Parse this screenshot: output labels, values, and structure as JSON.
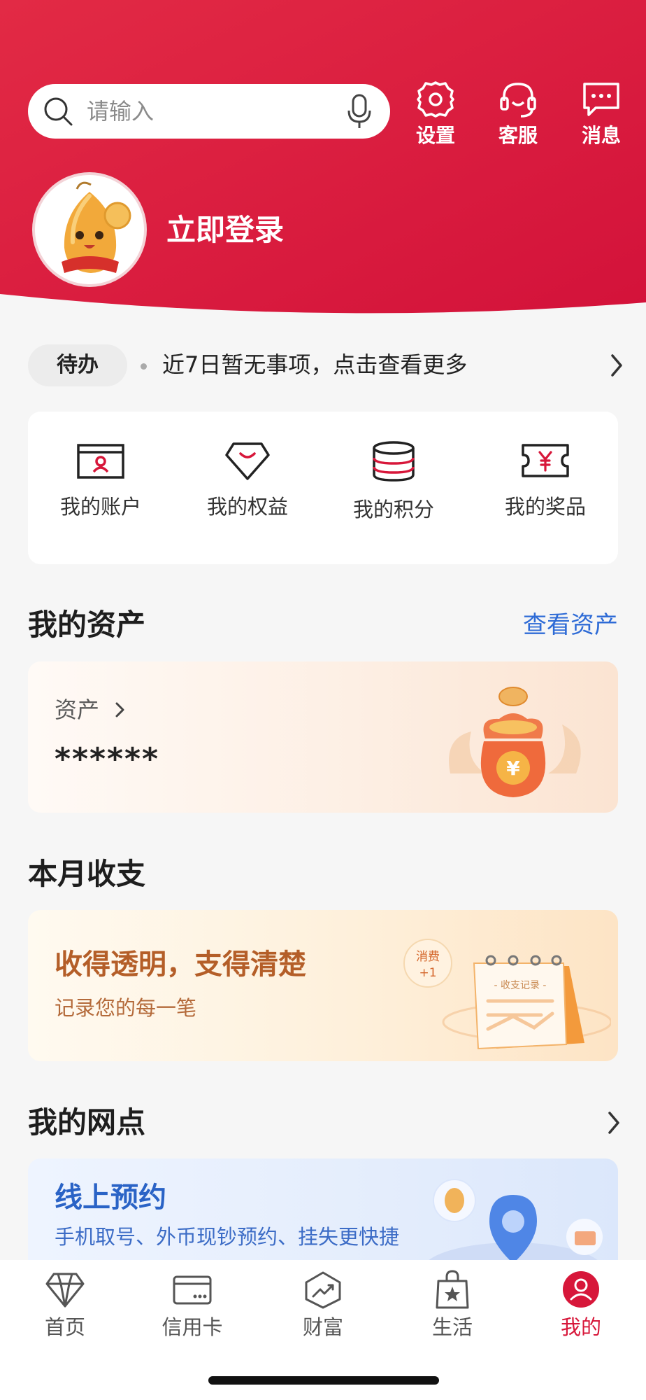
{
  "search": {
    "placeholder": "请输入"
  },
  "header_buttons": [
    {
      "label": "设置",
      "icon": "gear-icon"
    },
    {
      "label": "客服",
      "icon": "headset-icon"
    },
    {
      "label": "消息",
      "icon": "message-icon"
    }
  ],
  "profile": {
    "login_label": "立即登录"
  },
  "todo": {
    "badge": "待办",
    "text": "近7日暂无事项，点击查看更多"
  },
  "quick_grid": [
    {
      "label": "我的账户",
      "icon": "account-card-icon"
    },
    {
      "label": "我的权益",
      "icon": "diamond-benefit-icon"
    },
    {
      "label": "我的积分",
      "icon": "points-coins-icon"
    },
    {
      "label": "我的奖品",
      "icon": "prize-ticket-icon"
    }
  ],
  "assets": {
    "title": "我的资产",
    "link": "查看资产",
    "label": "资产",
    "value": "******"
  },
  "income": {
    "title": "本月收支",
    "card_title": "收得透明，支得清楚",
    "card_sub": "记录您的每一笔",
    "bubble_top": "消费",
    "bubble_bottom": "+1",
    "calendar_label": "- 收支记录 -"
  },
  "branch": {
    "title": "我的网点",
    "card_title": "线上预约",
    "card_sub": "手机取号、外币现钞预约、挂失更快捷"
  },
  "tabbar": [
    {
      "label": "首页",
      "icon": "diamond-home-icon",
      "active": false
    },
    {
      "label": "信用卡",
      "icon": "credit-card-icon",
      "active": false
    },
    {
      "label": "财富",
      "icon": "wealth-chart-icon",
      "active": false
    },
    {
      "label": "生活",
      "icon": "shopping-bag-icon",
      "active": false
    },
    {
      "label": "我的",
      "icon": "user-profile-icon",
      "active": true
    }
  ],
  "colors": {
    "brand_red": "#dc1c3c",
    "link_blue": "#2e6bd6",
    "income_brown": "#b45e28",
    "branch_blue": "#2a63c6"
  }
}
